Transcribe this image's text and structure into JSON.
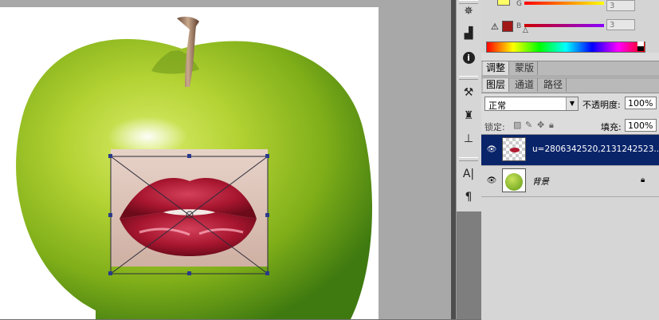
{
  "document": {
    "image_content": "green-apple-with-lips"
  },
  "color_panel": {
    "g_label": "G",
    "g_value": "3",
    "b_label": "B",
    "b_value": "3",
    "warning_icon": "warning-triangle-icon",
    "fg_swatch_color": "#ffff66",
    "gamut_swatch_color": "#a01818"
  },
  "dock_icons": [
    "navigator-icon",
    "histogram-icon",
    "info-icon",
    "brush-preset-icon",
    "clone-source-icon",
    "tool-preset-icon",
    "character-icon",
    "paragraph-icon"
  ],
  "adjust_tabs": [
    "调整",
    "蒙版"
  ],
  "layer_tabs": [
    "图层",
    "通道",
    "路径"
  ],
  "layers_panel": {
    "blend_mode": "正常",
    "opacity_label": "不透明度:",
    "opacity_value": "100%",
    "lock_label": "锁定:",
    "fill_label": "填充:",
    "fill_value": "100%"
  },
  "layers": [
    {
      "name": "u=2806342520,2131242523...",
      "selected": true
    },
    {
      "name": "背景",
      "selected": false,
      "locked": true
    }
  ]
}
